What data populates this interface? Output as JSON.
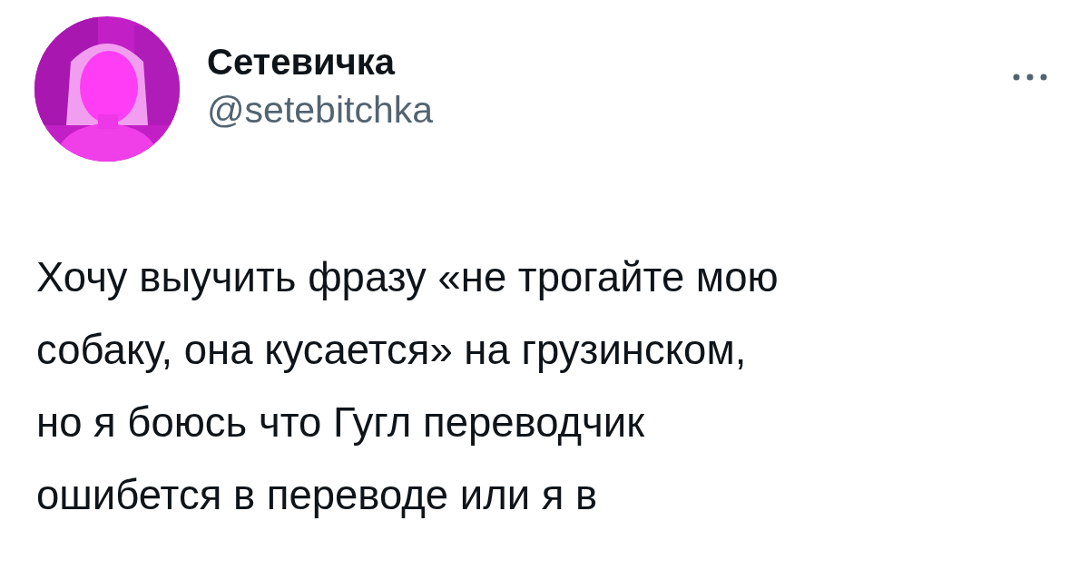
{
  "author": {
    "name": "Сетевичка",
    "handle": "@setebitchka"
  },
  "tweet": {
    "lines": [
      "Хочу выучить фразу «не трогайте мою",
      "собаку, она кусается» на грузинском,",
      "но я боюсь что Гугл переводчик",
      "ошибется в переводе или я в"
    ]
  }
}
